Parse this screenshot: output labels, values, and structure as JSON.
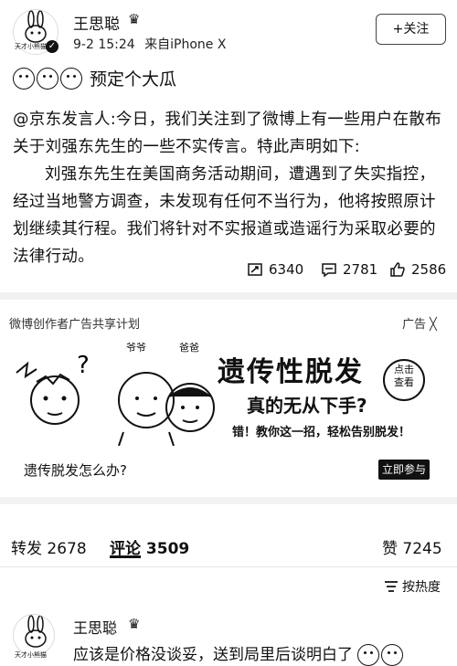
{
  "post": {
    "author": "王思聪",
    "avatar_caption": "天才小熊猫",
    "timestamp": "9-2 15:24",
    "source": "来自iPhone X",
    "follow_label": "+关注",
    "headline": "预定个大瓜",
    "paragraph1": "@京东发言人:今日，我们关注到了微博上有一些用户在散布关于刘强东先生的一些不实传言。特此声明如下:",
    "paragraph2": "刘强东先生在美国商务活动期间，遭遇到了失实指控，经过当地警方调查，未发现有任何不当行为，他将按照原计划继续其行程。我们将针对不实报道或造谣行为采取必要的法律行动。",
    "stats": {
      "repost": "6340",
      "comment": "2781",
      "like": "2586"
    }
  },
  "ad": {
    "program": "微博创作者广告共享计划",
    "tag": "广告",
    "grandpa": "爷爷",
    "father": "爸爸",
    "title": "遗传性脱发",
    "subtitle": "真的无从下手?",
    "slogan": "错！教你这一招，轻松告别脱发！",
    "badge": "点击\n查看",
    "caption": "遗传脱发怎么办?",
    "cta": "立即参与"
  },
  "tabs": {
    "repost": "转发 2678",
    "comment": "评论 3509",
    "like": "赞 7245"
  },
  "sort": "按热度",
  "comment": {
    "author": "王思聪",
    "avatar_caption": "天才小熊猫",
    "text": "应该是价格没谈妥，送到局里后谈明白了"
  },
  "colors": {
    "text": "#111111",
    "muted": "#333333",
    "divider": "#f2f2f2"
  }
}
